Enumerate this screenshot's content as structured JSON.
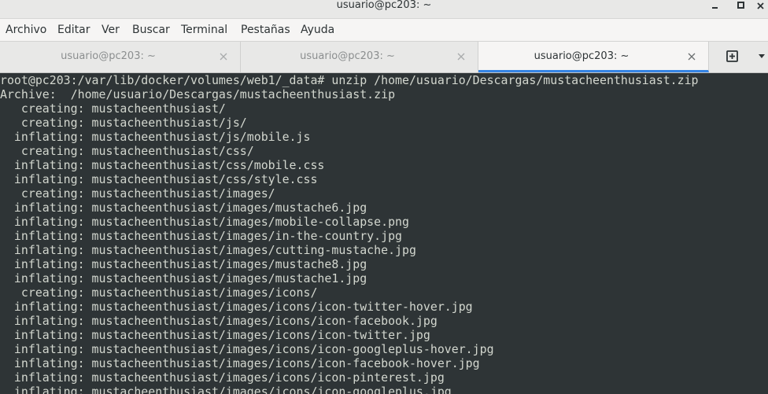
{
  "window": {
    "title": "usuario@pc203: ~"
  },
  "menubar": {
    "items": [
      "Archivo",
      "Editar",
      "Ver",
      "Buscar",
      "Terminal",
      "Pestañas",
      "Ayuda"
    ]
  },
  "tabs": [
    {
      "label": "usuario@pc203: ~",
      "active": false
    },
    {
      "label": "usuario@pc203: ~",
      "active": false
    },
    {
      "label": "usuario@pc203: ~",
      "active": true
    }
  ],
  "terminal": {
    "lines": [
      "root@pc203:/var/lib/docker/volumes/web1/_data# unzip /home/usuario/Descargas/mustacheenthusiast.zip",
      "Archive:  /home/usuario/Descargas/mustacheenthusiast.zip",
      "   creating: mustacheenthusiast/",
      "   creating: mustacheenthusiast/js/",
      "  inflating: mustacheenthusiast/js/mobile.js",
      "   creating: mustacheenthusiast/css/",
      "  inflating: mustacheenthusiast/css/mobile.css",
      "  inflating: mustacheenthusiast/css/style.css",
      "   creating: mustacheenthusiast/images/",
      "  inflating: mustacheenthusiast/images/mustache6.jpg",
      "  inflating: mustacheenthusiast/images/mobile-collapse.png",
      "  inflating: mustacheenthusiast/images/in-the-country.jpg",
      "  inflating: mustacheenthusiast/images/cutting-mustache.jpg",
      "  inflating: mustacheenthusiast/images/mustache8.jpg",
      "  inflating: mustacheenthusiast/images/mustache1.jpg",
      "   creating: mustacheenthusiast/images/icons/",
      "  inflating: mustacheenthusiast/images/icons/icon-twitter-hover.jpg",
      "  inflating: mustacheenthusiast/images/icons/icon-facebook.jpg",
      "  inflating: mustacheenthusiast/images/icons/icon-twitter.jpg",
      "  inflating: mustacheenthusiast/images/icons/icon-googleplus-hover.jpg",
      "  inflating: mustacheenthusiast/images/icons/icon-facebook-hover.jpg",
      "  inflating: mustacheenthusiast/images/icons/icon-pinterest.jpg",
      "  inflating: mustacheenthusiast/images/icons/icon-googleplus.jpg"
    ]
  },
  "colors": {
    "terminal_bg": "#2e3436",
    "terminal_fg": "#d3d7cf",
    "active_tab_indicator": "#3584e4"
  }
}
